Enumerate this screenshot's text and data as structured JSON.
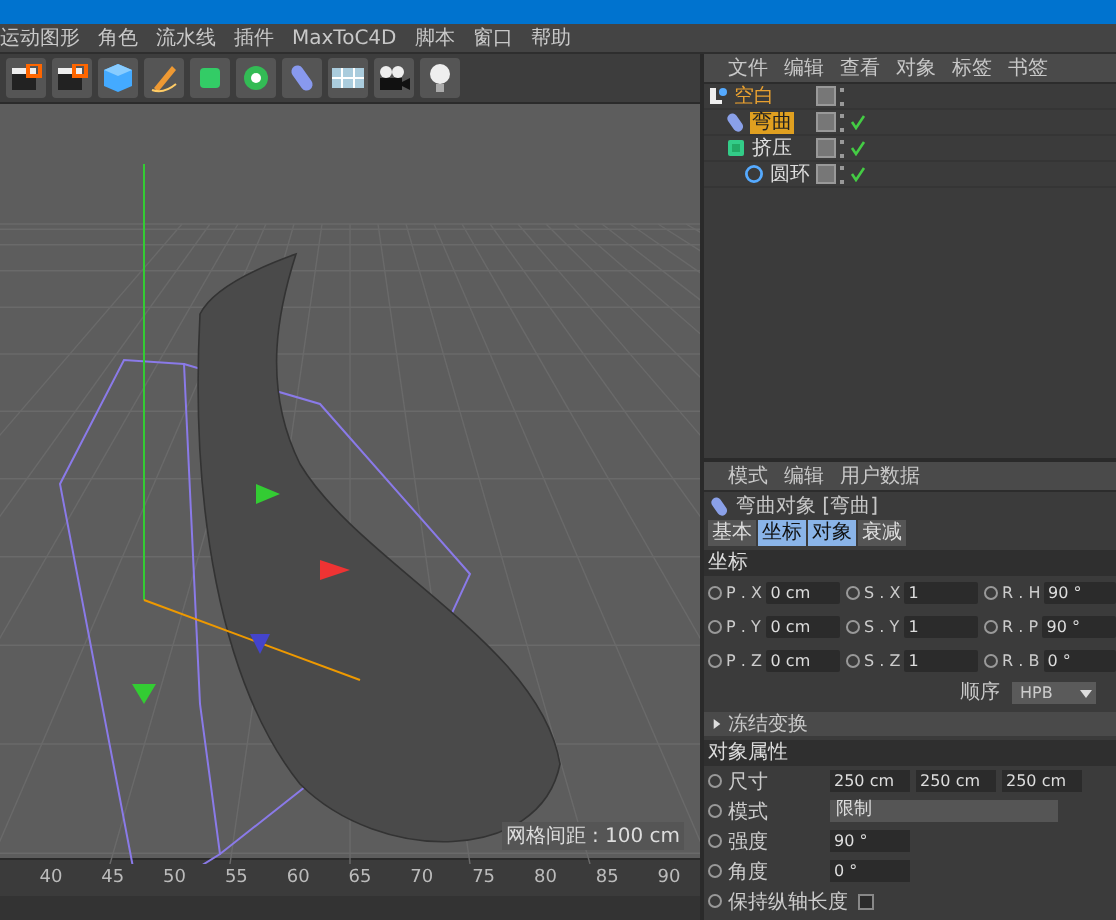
{
  "menu_bar": {
    "items": [
      "运动图形",
      "角色",
      "流水线",
      "插件",
      "MaxToC4D",
      "脚本",
      "窗口",
      "帮助"
    ]
  },
  "viewport": {
    "grid_spacing": "网格间距 : 100 cm"
  },
  "timeline": {
    "ticks": [
      "40",
      "45",
      "50",
      "55",
      "60",
      "65",
      "70",
      "75",
      "80",
      "85",
      "90"
    ]
  },
  "object_manager": {
    "menu": [
      "文件",
      "编辑",
      "查看",
      "对象",
      "标签",
      "书签"
    ],
    "objects": [
      {
        "name": "空白",
        "kind": "null",
        "selected": false,
        "enabled": false,
        "children": [
          {
            "name": "弯曲",
            "kind": "bend",
            "selected": true,
            "enabled": true
          },
          {
            "name": "挤压",
            "kind": "extrude",
            "selected": false,
            "enabled": true,
            "children": [
              {
                "name": "圆环",
                "kind": "circle",
                "selected": false,
                "enabled": true
              }
            ]
          }
        ]
      }
    ]
  },
  "attributes": {
    "menu": [
      "模式",
      "编辑",
      "用户数据"
    ],
    "object_title": "弯曲对象 [弯曲]",
    "tabs": [
      {
        "label": "基本",
        "selected": false
      },
      {
        "label": "坐标",
        "selected": true
      },
      {
        "label": "对象",
        "selected": true
      },
      {
        "label": "衰减",
        "selected": false
      }
    ],
    "coord_section": "坐标",
    "coords": [
      [
        {
          "label": "P . X",
          "value": "0 cm"
        },
        {
          "label": "S . X",
          "value": "1"
        },
        {
          "label": "R . H",
          "value": "90 °"
        }
      ],
      [
        {
          "label": "P . Y",
          "value": "0 cm"
        },
        {
          "label": "S . Y",
          "value": "1"
        },
        {
          "label": "R . P",
          "value": "90 °"
        }
      ],
      [
        {
          "label": "P . Z",
          "value": "0 cm"
        },
        {
          "label": "S . Z",
          "value": "1"
        },
        {
          "label": "R . B",
          "value": "0 °"
        }
      ]
    ],
    "order": {
      "label": "顺序",
      "value": "HPB"
    },
    "freeze": {
      "label": "冻结变换",
      "expanded": false
    },
    "object_section": "对象属性",
    "properties": [
      {
        "kind": "triple",
        "label": "尺寸",
        "values": [
          "250 cm",
          "250 cm",
          "250 cm"
        ]
      },
      {
        "kind": "dropdown",
        "label": "模式",
        "values": [
          "限制"
        ]
      },
      {
        "kind": "single",
        "label": "强度",
        "values": [
          "90 °"
        ]
      },
      {
        "kind": "single",
        "label": "角度",
        "values": [
          "0 °"
        ]
      },
      {
        "kind": "checkbox",
        "label": "保持纵轴长度",
        "checked": false
      }
    ]
  }
}
